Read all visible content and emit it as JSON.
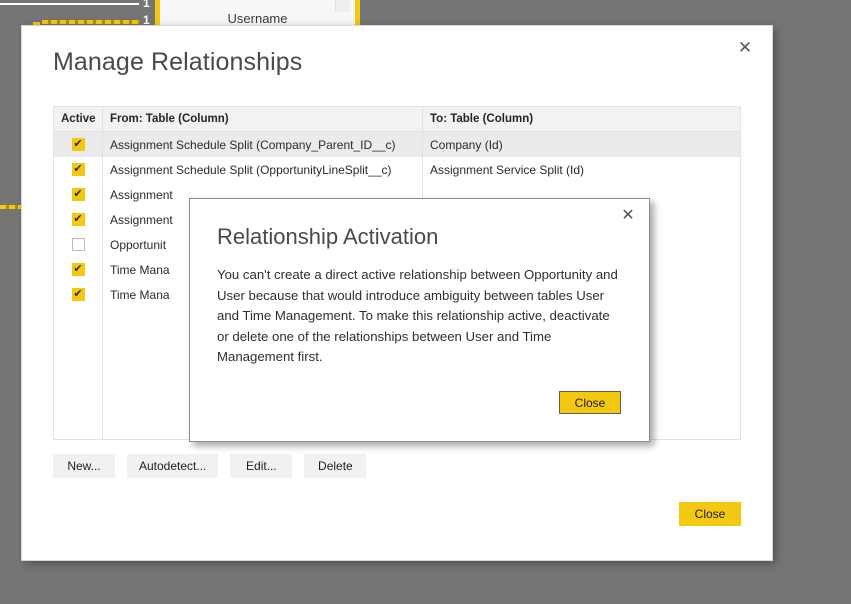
{
  "background": {
    "card_title": "Username",
    "cardinality_labels": [
      "1",
      "1"
    ],
    "accent_color": "#f2c811",
    "overlay_color": "#757575"
  },
  "modal": {
    "title": "Manage Relationships",
    "close_icon": "close-icon",
    "close_glyph": "✕",
    "table": {
      "columns": [
        "Active",
        "From: Table (Column)",
        "To: Table (Column)"
      ],
      "rows": [
        {
          "active": true,
          "from": "Assignment Schedule Split (Company_Parent_ID__c)",
          "to": "Company (Id)",
          "highlighted": true
        },
        {
          "active": true,
          "from": "Assignment Schedule Split (OpportunityLineSplit__c)",
          "to": "Assignment Service Split (Id)",
          "highlighted": false
        },
        {
          "active": true,
          "from": "Assignment",
          "to": "",
          "highlighted": false
        },
        {
          "active": true,
          "from": "Assignment",
          "to": "",
          "highlighted": false
        },
        {
          "active": false,
          "from": "Opportunit",
          "to": "",
          "highlighted": false
        },
        {
          "active": true,
          "from": "Time Mana",
          "to": "",
          "highlighted": false
        },
        {
          "active": true,
          "from": "Time Mana",
          "to": "",
          "highlighted": false
        }
      ],
      "checked_glyph": "✔"
    },
    "buttons": {
      "new": "New...",
      "autodetect": "Autodetect...",
      "edit": "Edit...",
      "delete": "Delete",
      "close": "Close"
    }
  },
  "inner_dialog": {
    "title": "Relationship Activation",
    "close_icon": "close-icon",
    "close_glyph": "✕",
    "message": "You can't create a direct active relationship between Opportunity and User because that would introduce ambiguity between tables User and Time Management. To make this relationship active, deactivate or delete one of the relationships between User and Time Management first.",
    "button_label": "Close"
  }
}
